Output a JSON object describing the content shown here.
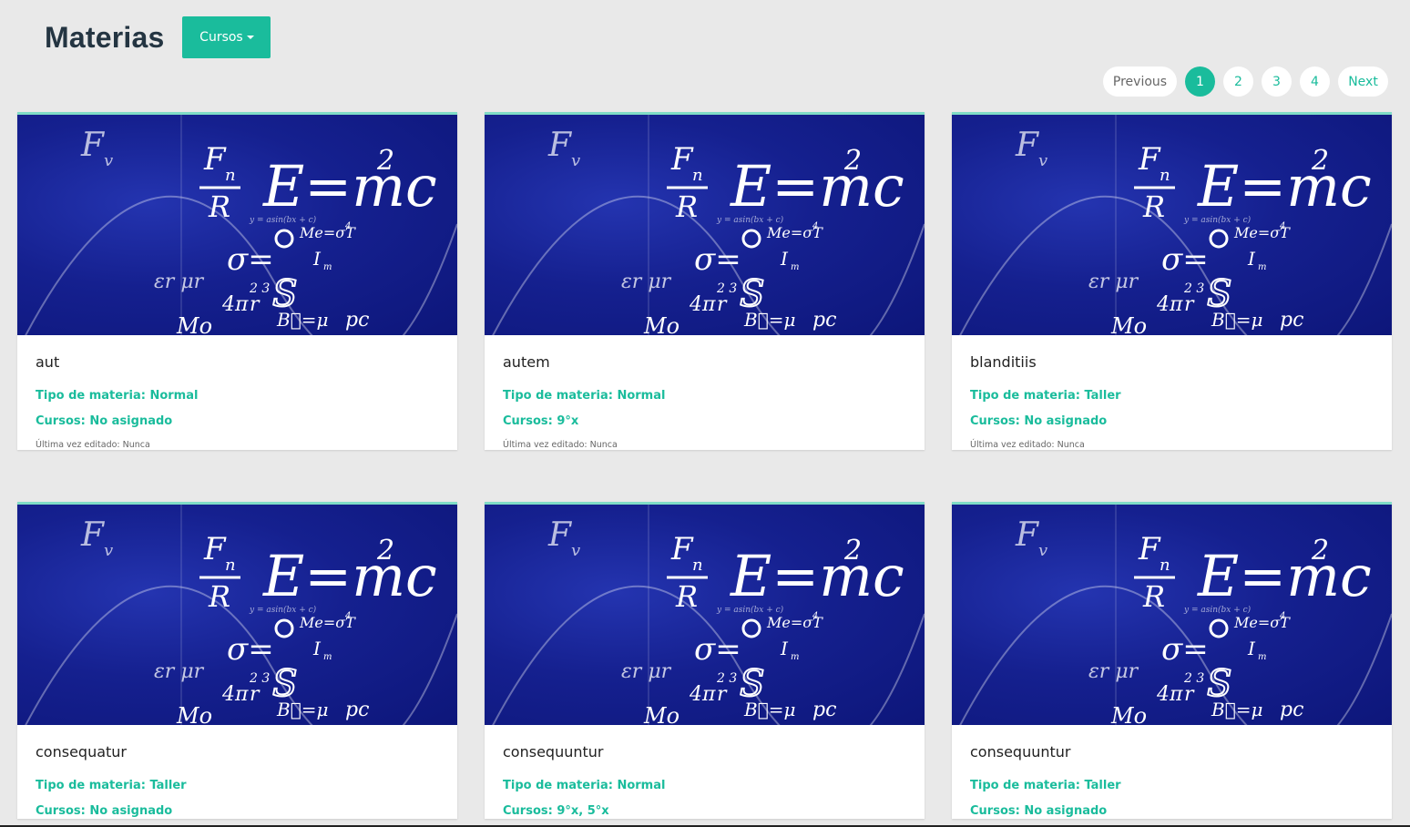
{
  "header": {
    "title": "Materias",
    "cursos_label": "Cursos"
  },
  "pagination": {
    "previous": "Previous",
    "pages": [
      "1",
      "2",
      "3",
      "4"
    ],
    "active": "1",
    "next": "Next"
  },
  "image": {
    "formula": "E=mc",
    "exponent": "2",
    "fn": "F",
    "fn_sub": "n",
    "fv": "F",
    "fv_sub": "v",
    "r": "R",
    "me": "Me=σT",
    "me_sup": "4",
    "sigma": "σ=",
    "im": "I",
    "im_sub": "m",
    "pi": "4π",
    "pi_sup": "2 3",
    "pi_r": "r",
    "pc": "pc",
    "b": "B⃗=μ",
    "mo": "Mo",
    "sin": "y = asin(bx + c)",
    "er": "εr μr",
    "colors": {
      "bg": "#15208f",
      "ink": "#ffffff"
    }
  },
  "cards": [
    {
      "name": "aut",
      "tipo": "Tipo de materia: Normal",
      "cursos": "Cursos: No asignado",
      "edit": "Última vez editado: Nunca"
    },
    {
      "name": "autem",
      "tipo": "Tipo de materia: Normal",
      "cursos": "Cursos: 9°x",
      "edit": "Última vez editado: Nunca"
    },
    {
      "name": "blanditiis",
      "tipo": "Tipo de materia: Taller",
      "cursos": "Cursos: No asignado",
      "edit": "Última vez editado: Nunca"
    },
    {
      "name": "consequatur",
      "tipo": "Tipo de materia: Taller",
      "cursos": "Cursos: No asignado",
      "edit": ""
    },
    {
      "name": "consequuntur",
      "tipo": "Tipo de materia: Normal",
      "cursos": "Cursos: 9°x, 5°x",
      "edit": ""
    },
    {
      "name": "consequuntur",
      "tipo": "Tipo de materia: Taller",
      "cursos": "Cursos: No asignado",
      "edit": ""
    }
  ],
  "accent_color": "#1abc9c"
}
